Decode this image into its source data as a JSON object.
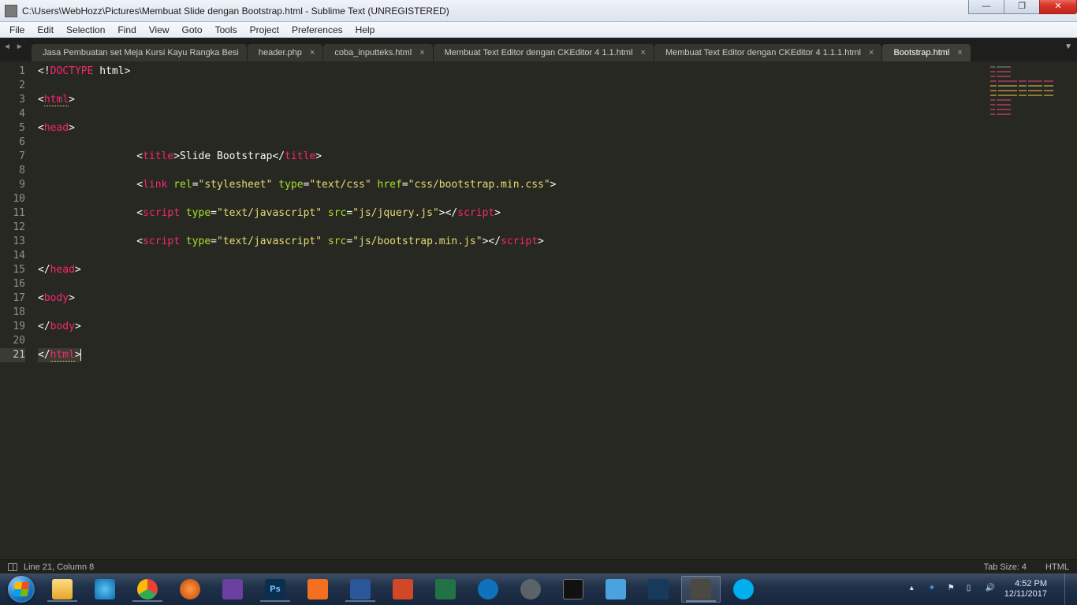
{
  "window": {
    "title": "C:\\Users\\WebHozz\\Pictures\\Membuat Slide dengan Bootstrap.html - Sublime Text (UNREGISTERED)"
  },
  "menu": {
    "items": [
      "File",
      "Edit",
      "Selection",
      "Find",
      "View",
      "Goto",
      "Tools",
      "Project",
      "Preferences",
      "Help"
    ]
  },
  "tabs": [
    {
      "label": "Jasa Pembuatan set Meja Kursi Kayu Rangka Besi",
      "dirty": false,
      "active": false,
      "closable": false
    },
    {
      "label": "header.php",
      "dirty": false,
      "active": false,
      "closable": true
    },
    {
      "label": "coba_inputteks.html",
      "dirty": false,
      "active": false,
      "closable": true
    },
    {
      "label": "Membuat Text Editor dengan CKEditor 4 1.1.html",
      "dirty": false,
      "active": false,
      "closable": true
    },
    {
      "label": "Membuat Text Editor dengan CKEditor 4 1.1.1.html",
      "dirty": false,
      "active": false,
      "closable": true
    },
    {
      "label": "Bootstrap.html",
      "dirty": false,
      "active": true,
      "closable": true
    }
  ],
  "code": {
    "lines": [
      {
        "n": 1,
        "tokens": [
          [
            "punct",
            "<!"
          ],
          [
            "doctype",
            "DOCTYPE"
          ],
          [
            "text-n",
            " html"
          ],
          [
            "punct",
            ">"
          ]
        ]
      },
      {
        "n": 2,
        "tokens": []
      },
      {
        "n": 3,
        "tokens": [
          [
            "punct",
            "<"
          ],
          [
            "tagname",
            "html",
            "u"
          ],
          [
            "punct",
            ">"
          ]
        ]
      },
      {
        "n": 4,
        "tokens": []
      },
      {
        "n": 5,
        "tokens": [
          [
            "punct",
            "<"
          ],
          [
            "tagname",
            "head"
          ],
          [
            "punct",
            ">"
          ]
        ]
      },
      {
        "n": 6,
        "tokens": []
      },
      {
        "n": 7,
        "tokens": [
          [
            "text-n",
            "                "
          ],
          [
            "punct",
            "<"
          ],
          [
            "tagname",
            "title"
          ],
          [
            "punct",
            ">"
          ],
          [
            "text-n",
            "Slide Bootstrap"
          ],
          [
            "punct",
            "</"
          ],
          [
            "tagname",
            "title"
          ],
          [
            "punct",
            ">"
          ]
        ]
      },
      {
        "n": 8,
        "tokens": []
      },
      {
        "n": 9,
        "tokens": [
          [
            "text-n",
            "                "
          ],
          [
            "punct",
            "<"
          ],
          [
            "tagname",
            "link"
          ],
          [
            "text-n",
            " "
          ],
          [
            "attr",
            "rel"
          ],
          [
            "punct",
            "="
          ],
          [
            "string",
            "\"stylesheet\""
          ],
          [
            "text-n",
            " "
          ],
          [
            "attr",
            "type"
          ],
          [
            "punct",
            "="
          ],
          [
            "string",
            "\"text/css\""
          ],
          [
            "text-n",
            " "
          ],
          [
            "attr",
            "href"
          ],
          [
            "punct",
            "="
          ],
          [
            "string",
            "\"css/bootstrap.min.css\""
          ],
          [
            "punct",
            ">"
          ]
        ]
      },
      {
        "n": 10,
        "tokens": []
      },
      {
        "n": 11,
        "tokens": [
          [
            "text-n",
            "                "
          ],
          [
            "punct",
            "<"
          ],
          [
            "tagname",
            "script"
          ],
          [
            "text-n",
            " "
          ],
          [
            "attr",
            "type"
          ],
          [
            "punct",
            "="
          ],
          [
            "string",
            "\"text/javascript\""
          ],
          [
            "text-n",
            " "
          ],
          [
            "attr",
            "src"
          ],
          [
            "punct",
            "="
          ],
          [
            "string",
            "\"js/jquery.js\""
          ],
          [
            "punct",
            "></"
          ],
          [
            "tagname",
            "script"
          ],
          [
            "punct",
            ">"
          ]
        ]
      },
      {
        "n": 12,
        "tokens": []
      },
      {
        "n": 13,
        "tokens": [
          [
            "text-n",
            "                "
          ],
          [
            "punct",
            "<"
          ],
          [
            "tagname",
            "script"
          ],
          [
            "text-n",
            " "
          ],
          [
            "attr",
            "type"
          ],
          [
            "punct",
            "="
          ],
          [
            "string",
            "\"text/javascript\""
          ],
          [
            "text-n",
            " "
          ],
          [
            "attr",
            "src"
          ],
          [
            "punct",
            "="
          ],
          [
            "string",
            "\"js/bootstrap.min.js\""
          ],
          [
            "punct",
            "></"
          ],
          [
            "tagname",
            "script"
          ],
          [
            "punct",
            ">"
          ]
        ]
      },
      {
        "n": 14,
        "tokens": []
      },
      {
        "n": 15,
        "tokens": [
          [
            "punct",
            "</"
          ],
          [
            "tagname",
            "head"
          ],
          [
            "punct",
            ">"
          ]
        ]
      },
      {
        "n": 16,
        "tokens": []
      },
      {
        "n": 17,
        "tokens": [
          [
            "punct",
            "<"
          ],
          [
            "tagname",
            "body"
          ],
          [
            "punct",
            ">"
          ]
        ]
      },
      {
        "n": 18,
        "tokens": []
      },
      {
        "n": 19,
        "tokens": [
          [
            "punct",
            "</"
          ],
          [
            "tagname",
            "body"
          ],
          [
            "punct",
            ">"
          ]
        ]
      },
      {
        "n": 20,
        "tokens": []
      },
      {
        "n": 21,
        "tokens": [
          [
            "punct",
            "</"
          ],
          [
            "tagname",
            "html",
            "u"
          ],
          [
            "punct",
            ">"
          ]
        ],
        "current": true,
        "cursor": true
      }
    ]
  },
  "status": {
    "position": "Line 21, Column 8",
    "tabsize": "Tab Size: 4",
    "syntax": "HTML"
  },
  "taskbar": {
    "items": [
      {
        "name": "file-explorer",
        "cls": "ic-explorer",
        "open": true
      },
      {
        "name": "internet-explorer",
        "cls": "ic-ie",
        "open": false
      },
      {
        "name": "chrome",
        "cls": "ic-chrome",
        "open": true
      },
      {
        "name": "firefox",
        "cls": "ic-ff",
        "open": false
      },
      {
        "name": "phpstorm",
        "cls": "ic-phpstorm",
        "open": false
      },
      {
        "name": "photoshop",
        "cls": "ic-ps",
        "open": true,
        "text": "Ps"
      },
      {
        "name": "xampp",
        "cls": "ic-xampp",
        "open": false
      },
      {
        "name": "word",
        "cls": "ic-word",
        "open": true
      },
      {
        "name": "powerpoint",
        "cls": "ic-ppt",
        "open": false
      },
      {
        "name": "excel",
        "cls": "ic-excel",
        "open": false
      },
      {
        "name": "teamviewer",
        "cls": "ic-teamviewer",
        "open": false
      },
      {
        "name": "settings",
        "cls": "ic-gear",
        "open": false
      },
      {
        "name": "cmd",
        "cls": "ic-cmd",
        "open": false
      },
      {
        "name": "regedit",
        "cls": "ic-regedit",
        "open": false
      },
      {
        "name": "virtualbox",
        "cls": "ic-vbox",
        "open": false
      },
      {
        "name": "sublime-text",
        "cls": "ic-sublime",
        "open": true,
        "active": true
      },
      {
        "name": "skype",
        "cls": "ic-skype",
        "open": false
      }
    ]
  },
  "clock": {
    "time": "4:52 PM",
    "date": "12/11/2017"
  },
  "tray_icons": [
    "up-arrow",
    "bluetooth",
    "flag",
    "speaker",
    "network"
  ]
}
